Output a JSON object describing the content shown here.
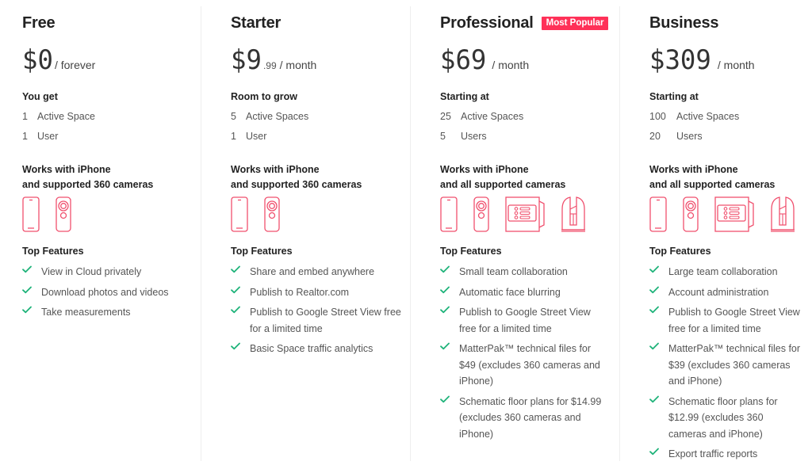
{
  "colors": {
    "accent": "#ff3158",
    "device_stroke": "#f0506e",
    "check": "#1fb37a",
    "divider": "#eeeeee"
  },
  "plans": [
    {
      "name": "Free",
      "badge": null,
      "price": {
        "main": "$0",
        "cents": "",
        "period": "/ forever"
      },
      "quota_title": "You get",
      "quotas": [
        {
          "num": "1",
          "label": "Active Space"
        },
        {
          "num": "1",
          "label": "User"
        }
      ],
      "works_line1": "Works with iPhone",
      "works_line2": "and supported 360 cameras",
      "devices": [
        "iphone-icon",
        "360-camera-icon"
      ],
      "features_title": "Top Features",
      "features": [
        "View in Cloud privately",
        "Download photos and videos",
        "Take measurements"
      ]
    },
    {
      "name": "Starter",
      "badge": null,
      "price": {
        "main": "$9",
        "cents": ".99",
        "period": "/ month"
      },
      "quota_title": "Room to grow",
      "quotas": [
        {
          "num": "5",
          "label": "Active Spaces"
        },
        {
          "num": "1",
          "label": "User"
        }
      ],
      "works_line1": "Works with iPhone",
      "works_line2": "and supported 360 cameras",
      "devices": [
        "iphone-icon",
        "360-camera-icon"
      ],
      "features_title": "Top Features",
      "features": [
        "Share and embed anywhere",
        "Publish to Realtor.com",
        "Publish to Google Street View free for a limited time",
        "Basic Space traffic analytics"
      ]
    },
    {
      "name": "Professional",
      "badge": "Most Popular",
      "price": {
        "main": "$69",
        "cents": "",
        "period": "/ month"
      },
      "quota_title": "Starting at",
      "quotas": [
        {
          "num": "25",
          "label": "Active Spaces"
        },
        {
          "num": "5",
          "label": "Users"
        }
      ],
      "works_line1": "Works with iPhone",
      "works_line2": "and all supported cameras",
      "devices": [
        "iphone-icon",
        "360-camera-icon",
        "pro-camera-icon",
        "lidar-camera-icon"
      ],
      "features_title": "Top Features",
      "features": [
        "Small team collaboration",
        "Automatic face blurring",
        "Publish to Google Street View free for a limited time",
        "MatterPak™ technical files for $49 (excludes 360 cameras and iPhone)",
        "Schematic floor plans for $14.99 (excludes 360 cameras and iPhone)"
      ]
    },
    {
      "name": "Business",
      "badge": null,
      "price": {
        "main": "$309",
        "cents": "",
        "period": "/ month"
      },
      "quota_title": "Starting at",
      "quotas": [
        {
          "num": "100",
          "label": "Active Spaces"
        },
        {
          "num": "20",
          "label": "Users"
        }
      ],
      "works_line1": "Works with iPhone",
      "works_line2": "and all supported cameras",
      "devices": [
        "iphone-icon",
        "360-camera-icon",
        "pro-camera-icon",
        "lidar-camera-icon"
      ],
      "features_title": "Top Features",
      "features": [
        "Large team collaboration",
        "Account administration",
        "Publish to Google Street View free for a limited time",
        "MatterPak™ technical files for $39 (excludes 360 cameras and iPhone)",
        "Schematic floor plans for $12.99 (excludes 360 cameras and iPhone)",
        "Export traffic reports"
      ]
    }
  ]
}
